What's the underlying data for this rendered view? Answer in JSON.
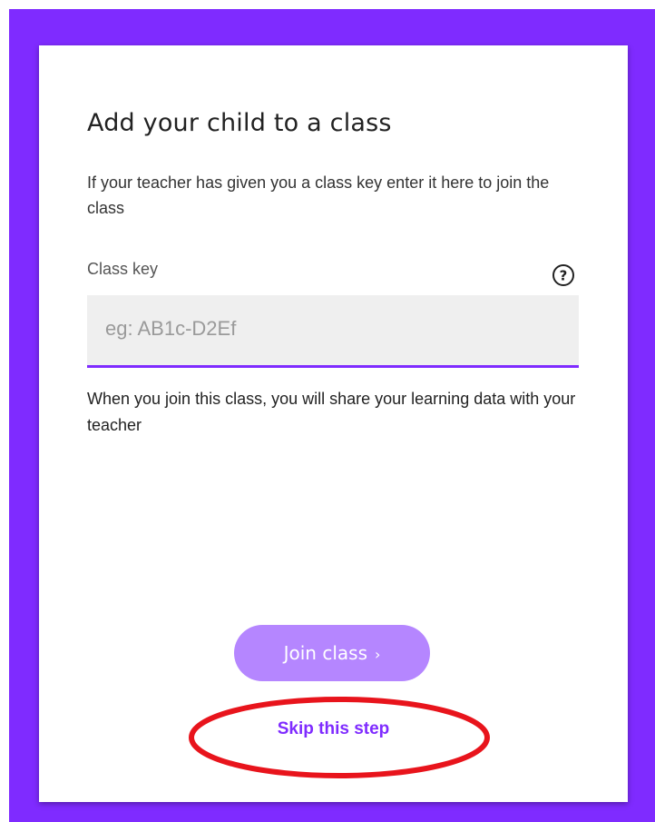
{
  "dialog": {
    "title": "Add your child to a class",
    "description": "If your teacher has given you a class key enter it here to join the class",
    "field_label": "Class key",
    "input_value": "",
    "input_placeholder": "eg: AB1c-D2Ef",
    "help_icon": "question-circle-icon",
    "share_note": "When you join this class, you will share your learning data with your teacher",
    "join_button_label": "Join class",
    "join_button_chevron": "›",
    "skip_link_label": "Skip this step"
  },
  "colors": {
    "background": "#7f2bff",
    "card": "#ffffff",
    "input_background": "#efefef",
    "input_underline": "#7f2bff",
    "join_button": "#b586ff",
    "skip_link": "#7f2bff",
    "annotation": "#e8141c"
  },
  "annotation": {
    "shape": "ellipse",
    "target": "skip_link_label"
  }
}
